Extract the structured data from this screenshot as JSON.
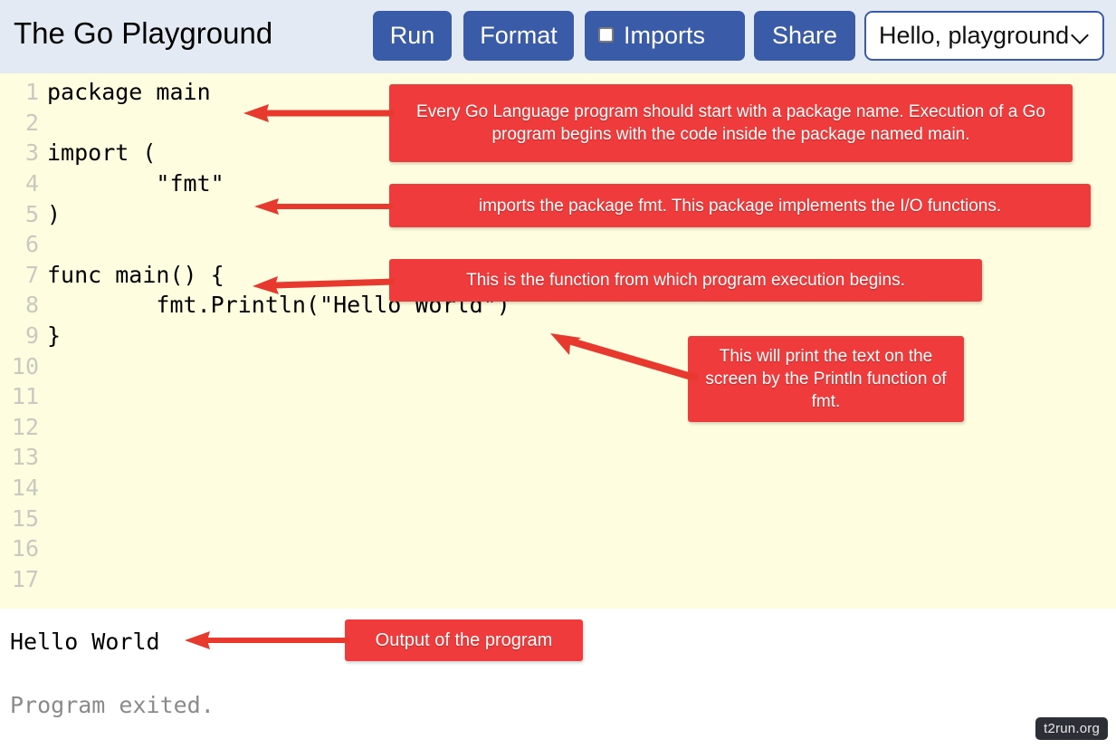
{
  "header": {
    "title": "The Go Playground",
    "buttons": {
      "run": "Run",
      "format": "Format",
      "imports": "Imports",
      "share": "Share"
    },
    "imports_checked": false,
    "select": {
      "value": "Hello, playground",
      "icon": "chevron-down-icon"
    }
  },
  "editor": {
    "background_color": "#fffddf",
    "lines": [
      {
        "num": "1",
        "text": "package main"
      },
      {
        "num": "2",
        "text": ""
      },
      {
        "num": "3",
        "text": "import ("
      },
      {
        "num": "4",
        "text": "        \"fmt\""
      },
      {
        "num": "5",
        "text": ")"
      },
      {
        "num": "6",
        "text": ""
      },
      {
        "num": "7",
        "text": "func main() {"
      },
      {
        "num": "8",
        "text": "        fmt.Println(\"Hello World\")"
      },
      {
        "num": "9",
        "text": "}"
      },
      {
        "num": "10",
        "text": ""
      },
      {
        "num": "11",
        "text": ""
      },
      {
        "num": "12",
        "text": ""
      },
      {
        "num": "13",
        "text": ""
      },
      {
        "num": "14",
        "text": ""
      },
      {
        "num": "15",
        "text": ""
      },
      {
        "num": "16",
        "text": ""
      },
      {
        "num": "17",
        "text": ""
      }
    ]
  },
  "output": {
    "text": "Hello World",
    "status": "Program exited."
  },
  "annotations": {
    "accent_color": "#ef3b3b",
    "package": "Every Go Language program should start with a package name. Execution of a Go program begins with the code inside the package named main.",
    "import": "imports the package fmt. This package implements the I/O functions.",
    "func": "This is the function from which program execution begins.",
    "println": "This will print the text on the screen by the Println function of fmt.",
    "output": "Output of the program"
  },
  "watermark": "t2run.org"
}
